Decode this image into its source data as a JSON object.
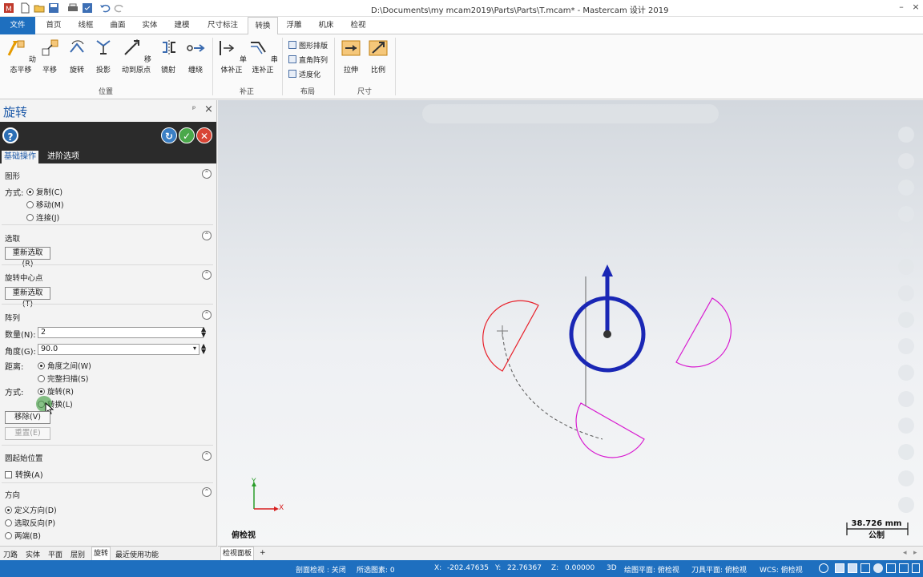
{
  "window": {
    "title": "D:\\Documents\\my mcam2019\\Parts\\Parts\\T.mcam* - Mastercam 设计 2019"
  },
  "ribbon": {
    "tabs": [
      "文件",
      "首页",
      "线框",
      "曲面",
      "实体",
      "建模",
      "尺寸标注",
      "转换",
      "浮雕",
      "机床",
      "检视"
    ],
    "active_tab": "转换",
    "groups": {
      "position": {
        "label": "位置",
        "buttons": [
          "动态平移",
          "平移",
          "旋转",
          "投影",
          "移动到原点",
          "镜射",
          "缠绕"
        ]
      },
      "offset": {
        "label": "补正",
        "buttons": [
          "单体补正",
          "串连补正"
        ]
      },
      "layout": {
        "label": "布局",
        "buttons": [
          "图形排版",
          "直角阵列",
          "适度化"
        ]
      },
      "size": {
        "label": "尺寸",
        "buttons": [
          "拉伸",
          "比例"
        ]
      }
    }
  },
  "panel": {
    "title": "旋转",
    "pin": "ᵖ",
    "close": "×",
    "tabs": [
      "基础操作",
      "进阶选项"
    ],
    "sections": {
      "geometry": {
        "title": "图形",
        "method_label": "方式:",
        "options": [
          "复制(C)",
          "移动(M)",
          "连接(J)"
        ],
        "selected": "复制(C)"
      },
      "select": {
        "title": "选取",
        "button": "重新选取(R)"
      },
      "center": {
        "title": "旋转中心点",
        "button": "重新选取(T)"
      },
      "array": {
        "title": "阵列",
        "count_label": "数量(N):",
        "count_value": "2",
        "angle_label": "角度(G):",
        "angle_value": "90.0",
        "distance_label": "距离:",
        "distance_options": [
          "角度之间(W)",
          "完整扫描(S)"
        ],
        "distance_selected": "角度之间(W)",
        "method_label": "方式:",
        "method_options": [
          "旋转(R)",
          "转换(L)"
        ],
        "method_selected": "旋转(R)",
        "remove_button": "移除(V)",
        "reset_button": "重置(E)"
      },
      "arc_start": {
        "title": "圆起始位置",
        "checkbox": "转换(A)"
      },
      "direction": {
        "title": "方向",
        "options": [
          "定义方向(D)",
          "选取反向(P)",
          "两端(B)"
        ],
        "selected": "定义方向(D)"
      }
    }
  },
  "manager_tabs": [
    "刀路",
    "实体",
    "平面",
    "层别",
    "旋转",
    "最近使用功能"
  ],
  "manager_active": "旋转",
  "viewport": {
    "view_name": "俯检视",
    "scale_value": "38.726 mm",
    "scale_unit": "公制",
    "axis_x": "X",
    "axis_y": "Y",
    "bottom_tab": "检视面板",
    "add_tab": "+",
    "colors": {
      "original": "#e8202a",
      "copies": "#d81bd0",
      "gnomon": "#1a27b5",
      "background_top": "#d3d8de"
    }
  },
  "status": {
    "section_view": "剖面检视 : 关闭",
    "selected": "所选图素: 0",
    "x_label": "X:",
    "x_value": "-202.47635",
    "y_label": "Y:",
    "y_value": "22.76367",
    "z_label": "Z:",
    "z_value": "0.00000",
    "mode": "3D",
    "gplane": "绘图平面: 俯检视",
    "tplane": "刀具平面: 俯检视",
    "wcs": "WCS: 俯检视"
  }
}
